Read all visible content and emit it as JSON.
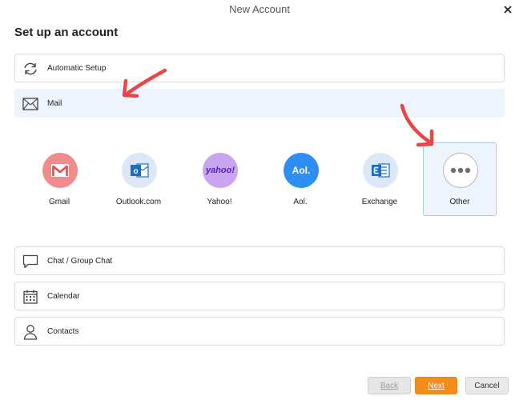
{
  "window": {
    "title": "New Account"
  },
  "heading": "Set up an account",
  "rows": {
    "automatic_setup": "Automatic Setup",
    "mail": "Mail",
    "chat": "Chat / Group Chat",
    "calendar": "Calendar",
    "contacts": "Contacts"
  },
  "providers": {
    "gmail": {
      "label": "Gmail",
      "color": "#f28b8b"
    },
    "outlook": {
      "label": "Outlook.com",
      "color": "#dce8f5",
      "logo_text": "o"
    },
    "yahoo": {
      "label": "Yahoo!",
      "color": "#c9a5f0",
      "logo_text": "yahoo!"
    },
    "aol": {
      "label": "Aol.",
      "color": "#2f8ef2",
      "logo_text": "Aol."
    },
    "exchange": {
      "label": "Exchange",
      "color": "#dce8f5"
    },
    "other": {
      "label": "Other",
      "color": "#ffffff",
      "selected": true
    }
  },
  "buttons": {
    "back": "Back",
    "next": "Next",
    "cancel": "Cancel"
  },
  "colors": {
    "accent": "#f28c1c",
    "selection_bg": "#eef4fd",
    "annotation_arrow": "#e8474a"
  }
}
